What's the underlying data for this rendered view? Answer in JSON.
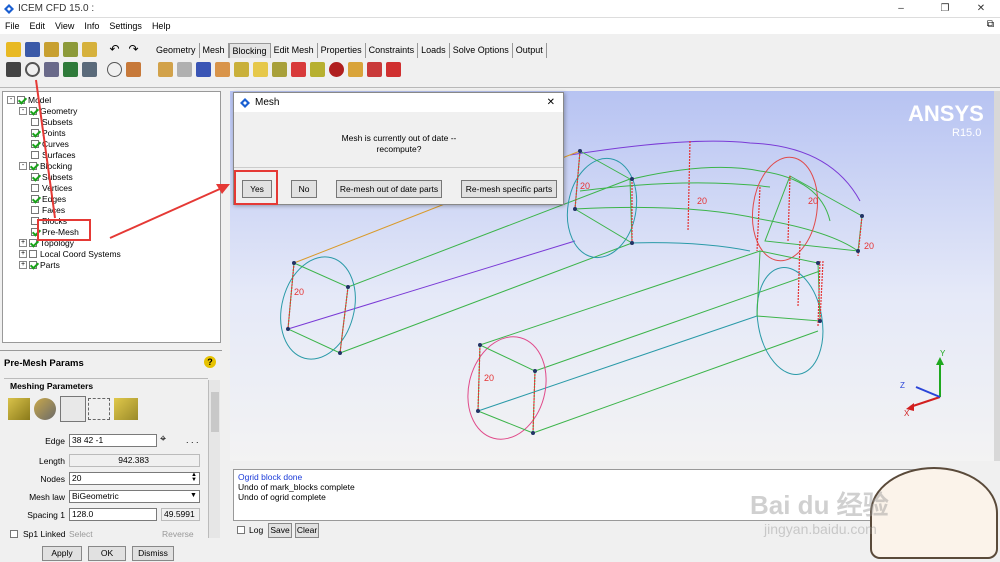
{
  "app": {
    "title": "ICEM CFD 15.0 :",
    "minimize": "–",
    "restore": "❐",
    "close": "✕"
  },
  "menu": [
    "File",
    "Edit",
    "View",
    "Info",
    "Settings",
    "Help"
  ],
  "tabs": [
    "Geometry",
    "Mesh",
    "Blocking",
    "Edit Mesh",
    "Properties",
    "Constraints",
    "Loads",
    "Solve Options",
    "Output"
  ],
  "active_tab": "Blocking",
  "tree": [
    {
      "label": "Model",
      "checked": true,
      "expand": "-"
    },
    {
      "label": "Geometry",
      "checked": true,
      "expand": "-"
    },
    {
      "label": "Subsets",
      "checked": false,
      "expand": ""
    },
    {
      "label": "Points",
      "checked": true,
      "expand": ""
    },
    {
      "label": "Curves",
      "checked": true,
      "expand": ""
    },
    {
      "label": "Surfaces",
      "checked": false,
      "expand": ""
    },
    {
      "label": "Blocking",
      "checked": true,
      "expand": "-"
    },
    {
      "label": "Subsets",
      "checked": true,
      "expand": ""
    },
    {
      "label": "Vertices",
      "checked": false,
      "expand": ""
    },
    {
      "label": "Edges",
      "checked": true,
      "expand": ""
    },
    {
      "label": "Faces",
      "checked": false,
      "expand": ""
    },
    {
      "label": "Blocks",
      "checked": false,
      "expand": ""
    },
    {
      "label": "Pre-Mesh",
      "checked": true,
      "expand": ""
    },
    {
      "label": "Topology",
      "checked": true,
      "expand": "+"
    },
    {
      "label": "Local Coord Systems",
      "checked": false,
      "expand": "+"
    },
    {
      "label": "Parts",
      "checked": true,
      "expand": "+"
    }
  ],
  "params": {
    "title": "Pre-Mesh Params",
    "group": "Meshing Parameters",
    "edge_label": "Edge",
    "edge_value": "38 42 -1",
    "length_label": "Length",
    "length_value": "942.383",
    "nodes_label": "Nodes",
    "nodes_value": "20",
    "meshlaw_label": "Mesh law",
    "meshlaw_value": "BiGeometric",
    "spacing1_label": "Spacing 1",
    "spacing1_value": "128.0",
    "spacing1_right": "49.5991",
    "sp1linked_label": "Sp1 Linked",
    "select_label": "Select",
    "reverse_label": "Reverse",
    "apply": "Apply",
    "ok": "OK",
    "dismiss": "Dismiss"
  },
  "dialog": {
    "title": "Mesh",
    "message": "Mesh is currently out of date -- recompute?",
    "yes": "Yes",
    "no": "No",
    "remesh_outdated": "Re-mesh out of date parts",
    "remesh_specific": "Re-mesh specific parts",
    "close": "✕"
  },
  "console": {
    "lines": [
      "Ogrid block done",
      "Undo of mark_blocks complete",
      "Undo of ogrid complete"
    ],
    "log": "Log",
    "save": "Save",
    "clear": "Clear"
  },
  "brand": {
    "name": "ANSYS",
    "version": "R15.0"
  },
  "edge_count": "20",
  "axes": {
    "y": "Y",
    "z": "Z",
    "x": "X"
  },
  "watermark": {
    "main": "Bai du 经验",
    "sub": "jingyan.baidu.com"
  },
  "colors": {
    "accent_blue": "#0b4fb5",
    "annotation_red": "#e53935",
    "edge_red": "#e53333"
  }
}
